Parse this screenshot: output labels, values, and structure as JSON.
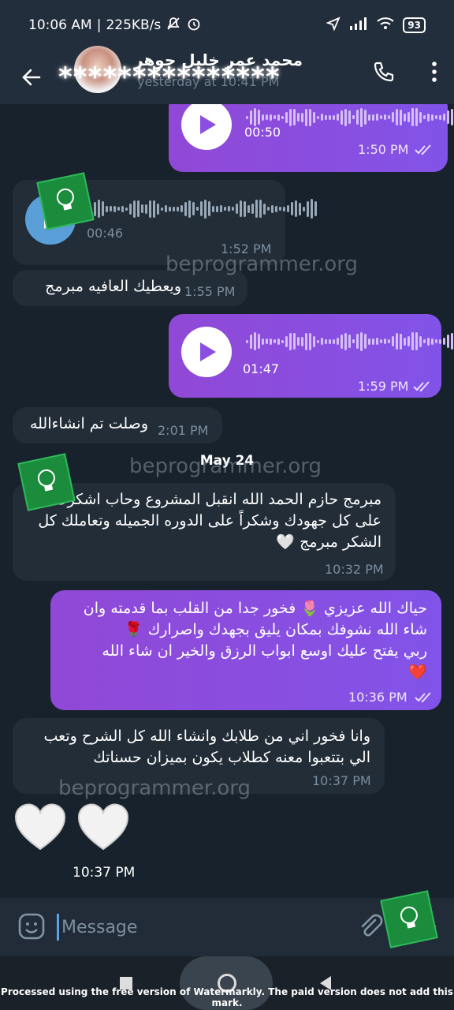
{
  "status_bar": {
    "time": "10:06 AM",
    "speed": "225KB/s",
    "battery": "93"
  },
  "header": {
    "title": "محمد عمر خليل جوهر",
    "subtitle": "yesterday at 10:41 PM",
    "masked": "***************"
  },
  "messages": [
    {
      "type": "voice",
      "direction": "out",
      "duration": "00:50",
      "time": "1:50 PM"
    },
    {
      "type": "voice",
      "direction": "in",
      "duration": "00:46",
      "time": "1:52 PM"
    },
    {
      "type": "text",
      "direction": "in",
      "text": "ويعطيك العافيه مبرمج",
      "time": "1:55 PM"
    },
    {
      "type": "voice",
      "direction": "out",
      "duration": "01:47",
      "time": "1:59 PM"
    },
    {
      "type": "text",
      "direction": "in",
      "text": "وصلت تم انشاءالله",
      "time": "2:01 PM"
    },
    {
      "type": "text",
      "direction": "in",
      "lines": [
        "مبرمج حازم الحمد الله انقبل المشروع وحاب اشكرك",
        "على كل جهودك وشكراً على الدوره الجميله وتعاملك كل",
        "الشكر مبرمج 🤍"
      ],
      "time": "10:32 PM"
    },
    {
      "type": "text",
      "direction": "out",
      "lines": [
        "حياك الله عزيزي 🌷 فخور جدا من القلب بما قدمته وان",
        "شاء الله نشوفك بمكان يليق بجهدك واصرارك 🌹",
        "ربي يفتح عليك اوسع ابواب الرزق والخير ان شاء الله",
        "❤️"
      ],
      "time": "10:36 PM"
    },
    {
      "type": "text",
      "direction": "in",
      "lines": [
        "وانا فخور اني من طلابك وانشاء الله كل الشرح وتعب",
        "الي بتتعبوا معنه كطلاب يكون بميزان حسناتك"
      ],
      "time": "10:37 PM"
    },
    {
      "type": "emoji",
      "direction": "in",
      "emoji": "🤍🤍",
      "time": "10:37 PM"
    }
  ],
  "date_separator": "May 24",
  "watermark_text": "beprogrammer.org",
  "composer": {
    "placeholder": "Message"
  },
  "footer_note": "Processed using the free version of Watermarkly. The paid version does not add this mark.",
  "colors": {
    "outgoing_bubble": "#8a4fe0",
    "incoming_bubble": "#222d38",
    "background": "#18222c",
    "header": "#232e3c"
  }
}
